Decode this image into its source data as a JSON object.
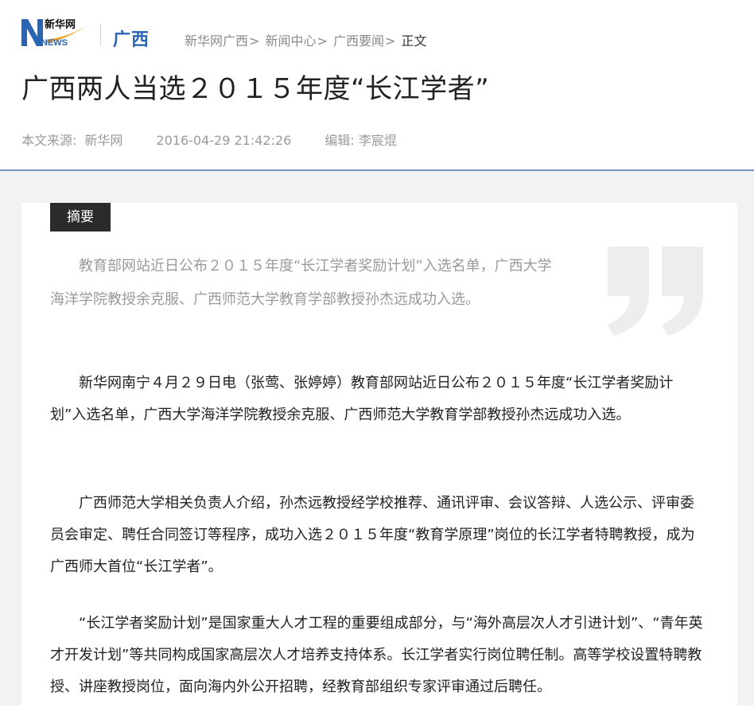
{
  "header": {
    "logo_text_top": "新华网",
    "logo_text_news": "NEWS",
    "region_label": "广西",
    "breadcrumb": [
      {
        "label": "新华网广西"
      },
      {
        "label": "新闻中心"
      },
      {
        "label": "广西要闻"
      }
    ],
    "breadcrumb_separator": ">",
    "breadcrumb_current": "正文"
  },
  "article": {
    "title": "广西两人当选２０１５年度“长江学者”",
    "source_label": "本文来源:",
    "source_value": "新华网",
    "datetime": "2016-04-29 21:42:26",
    "editor": "编辑: 李宸焜",
    "summary_tag": "摘要",
    "summary": "教育部网站近日公布２０１５年度“长江学者奖励计划”入选名单，广西大学海洋学院教授余克服、广西师范大学教育学部教授孙杰远成功入选。",
    "paragraphs": [
      "新华网南宁４月２９日电（张莺、张婷婷）教育部网站近日公布２０１５年度“长江学者奖励计划”入选名单，广西大学海洋学院教授余克服、广西师范大学教育学部教授孙杰远成功入选。",
      "广西师范大学相关负责人介绍，孙杰远教授经学校推荐、通讯评审、会议答辩、人选公示、评审委员会审定、聘任合同签订等程序，成功入选２０１５年度“教育学原理”岗位的长江学者特聘教授，成为广西师大首位“长江学者”。",
      "“长江学者奖励计划”是国家重大人才工程的重要组成部分，与“海外高层次人才引进计划”、“青年英才开发计划”等共同构成国家高层次人才培养支持体系。长江学者实行岗位聘任制。高等学校设置特聘教授、讲座教授岗位，面向海内外公开招聘，经教育部组织专家评审通过后聘任。"
    ]
  },
  "colors": {
    "brand_blue": "#2a64b5",
    "logo_orange": "#f5a623",
    "header_border": "#6f93c6",
    "tag_background": "#2b2b2b",
    "page_background": "#f2f2f2"
  },
  "icons": {
    "logo": "xinhua-news-logo",
    "quote": "closing-quote-icon"
  }
}
